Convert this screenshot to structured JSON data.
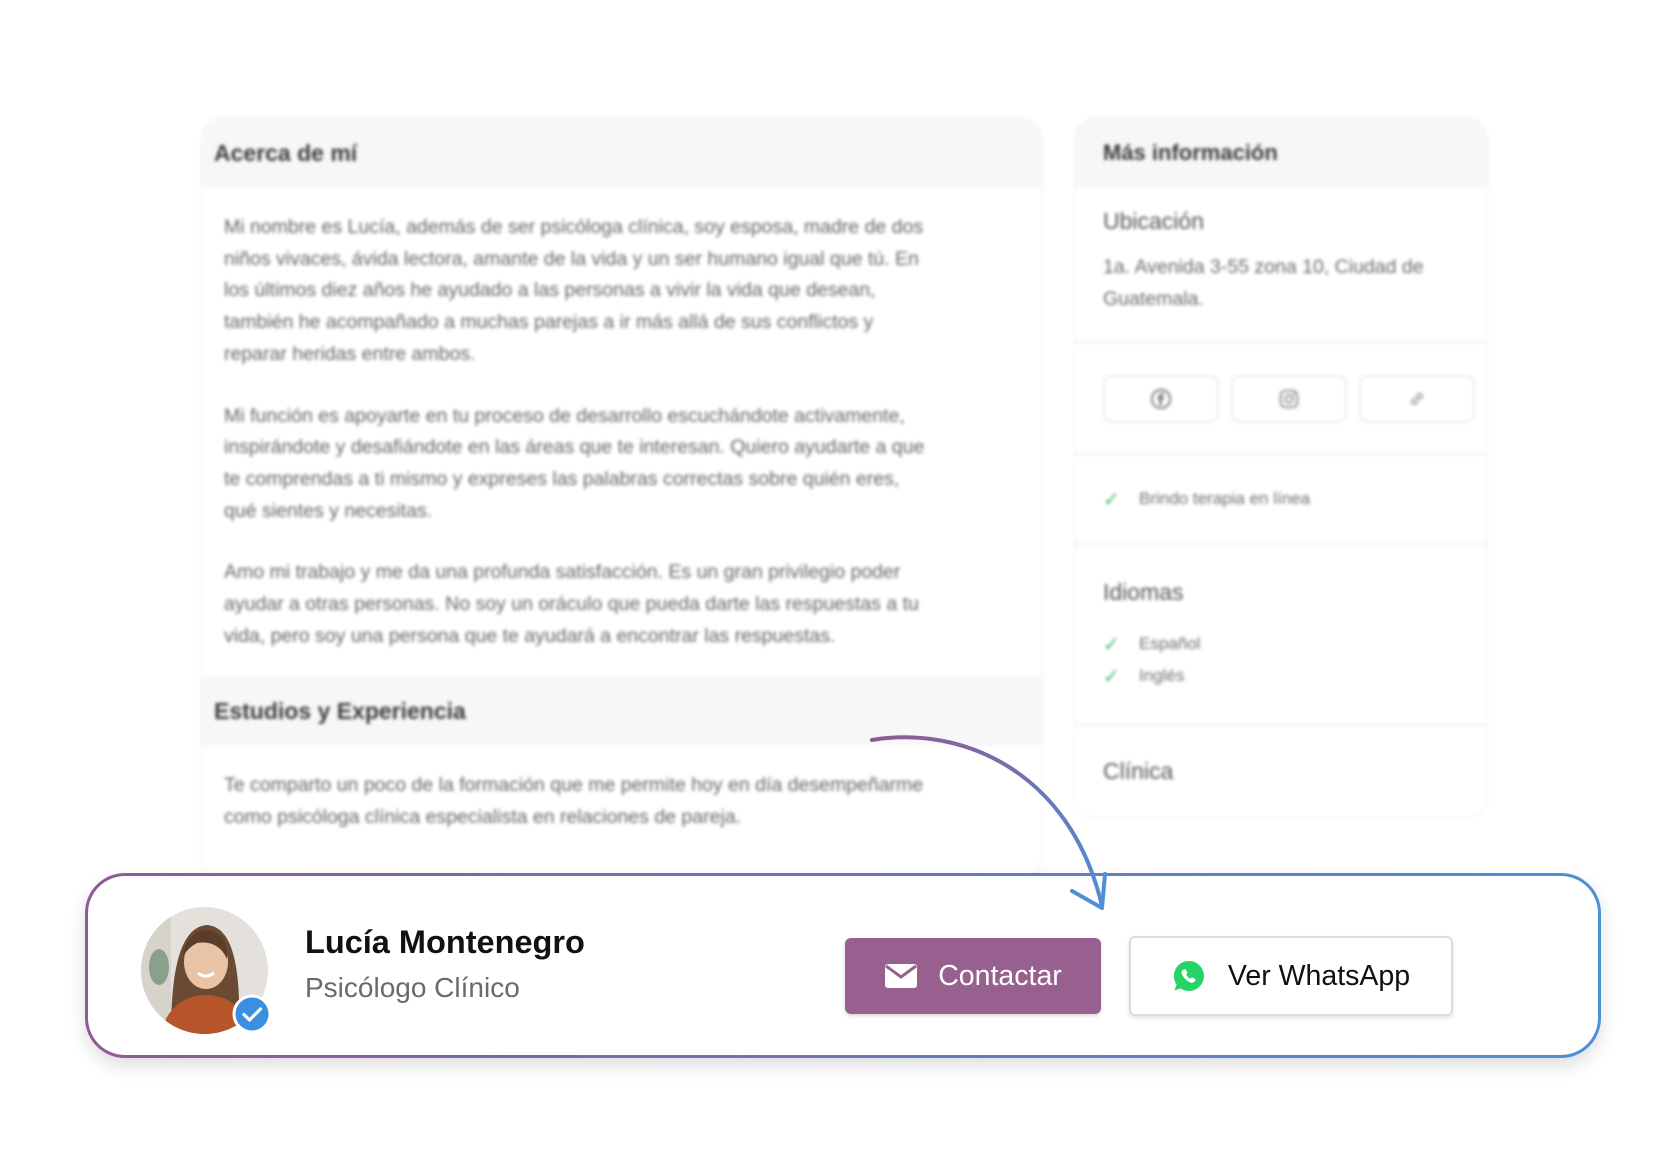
{
  "about": {
    "heading": "Acerca de mí",
    "paragraphs": [
      "Mi nombre es Lucía, además de ser psicóloga clínica, soy esposa, madre de dos\nniños vivaces, ávida lectora, amante de la vida y un ser humano igual que tú. En\nlos últimos diez años he ayudado a las personas a vivir la vida que desean,\ntambién he acompañado a muchas parejas a ir más allá de sus conflictos y\nreparar heridas entre ambos.",
      "Mi función es apoyarte en tu proceso de desarrollo escuchándote activamente,\ninspirándote y desafiándote en las áreas que te interesan. Quiero ayudarte a que\nte comprendas a ti mismo y expreses las palabras correctas sobre quién eres,\nqué sientes y necesitas.",
      "Amo mi trabajo y me da una profunda satisfacción. Es un gran privilegio poder\nayudar a otras personas. No soy un oráculo que pueda darte las respuestas a tu\nvida, pero soy una persona que te ayudará a encontrar las respuestas."
    ]
  },
  "studies": {
    "heading": "Estudios y Experiencia",
    "text": "Te comparto un poco de la formación que me permite hoy en día desempeñarme\ncomo psicóloga clínica especialista en relaciones de pareja."
  },
  "more_info": {
    "heading": "Más información",
    "location_title": "Ubicación",
    "location_text": "1a. Avenida 3-55 zona 10, Ciudad de\nGuatemala.",
    "social_icons": [
      "facebook-icon",
      "instagram-icon",
      "link-icon"
    ],
    "online_therapy": "Brindo terapia en línea",
    "languages_title": "Idiomas",
    "languages": [
      "Español",
      "Inglés"
    ],
    "clinic_title": "Clínica"
  },
  "profile": {
    "name": "Lucía Montenegro",
    "role": "Psicólogo Clínico",
    "verified": true
  },
  "actions": {
    "contact_label": "Contactar",
    "whatsapp_label": "Ver WhatsApp"
  },
  "colors": {
    "primary": "#98608f",
    "gradient_start": "#8f5a93",
    "gradient_end": "#4e8fd6",
    "whatsapp": "#25d366",
    "verified": "#3b8fe0",
    "check": "#4bb56a"
  }
}
